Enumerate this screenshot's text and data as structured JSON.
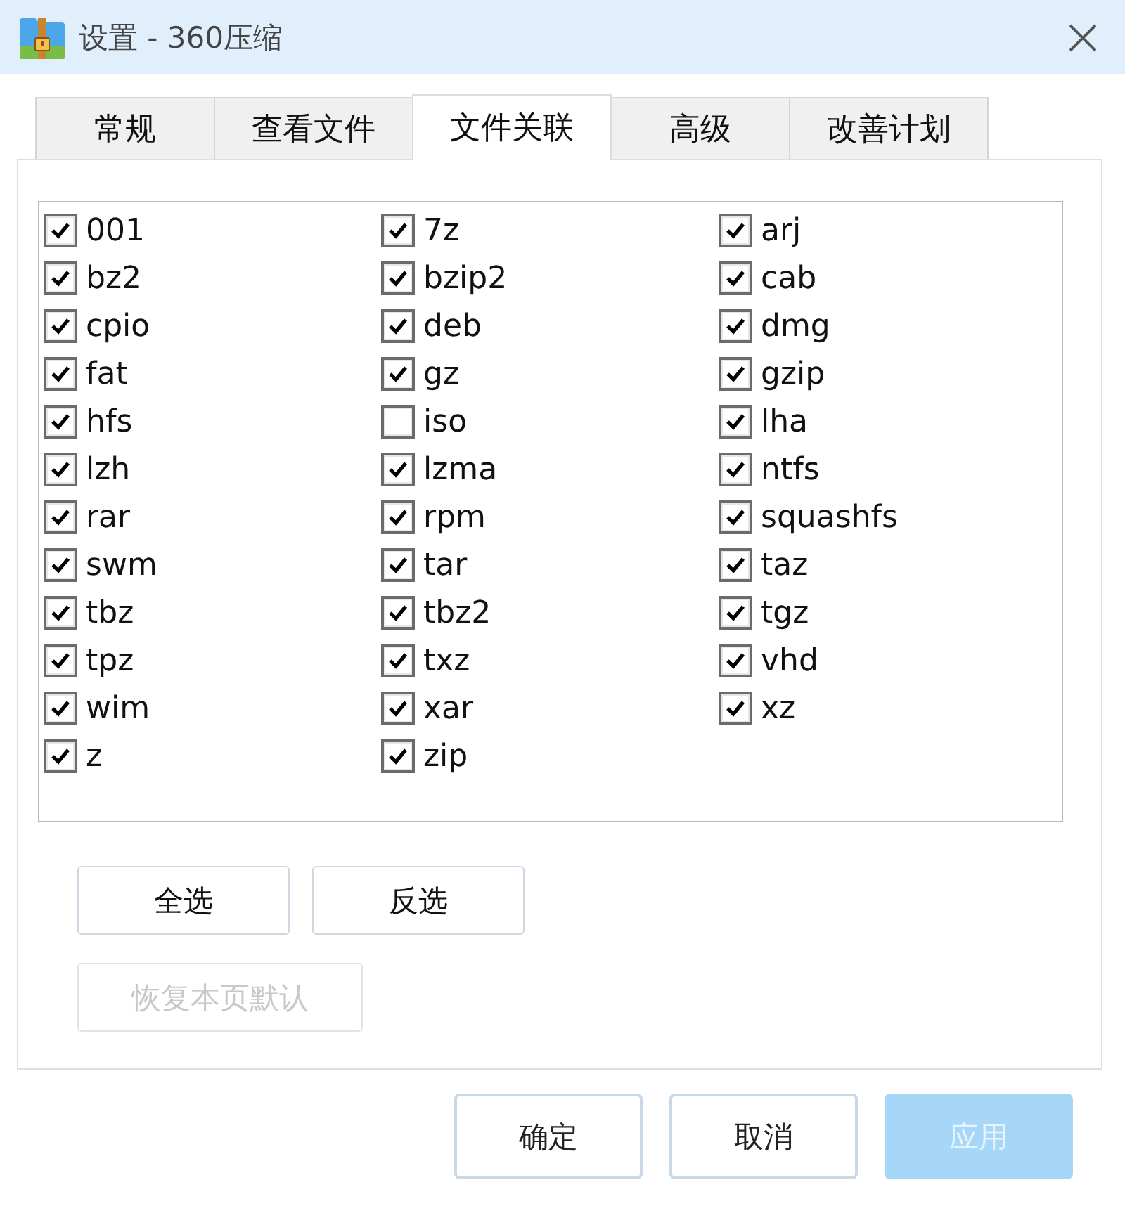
{
  "window": {
    "title": "设置 - 360压缩"
  },
  "tabs": [
    {
      "label": "常规",
      "selected": false
    },
    {
      "label": "查看文件",
      "selected": false
    },
    {
      "label": "文件关联",
      "selected": true
    },
    {
      "label": "高级",
      "selected": false
    },
    {
      "label": "改善计划",
      "selected": false
    }
  ],
  "file_types": [
    {
      "label": "001",
      "checked": true
    },
    {
      "label": "7z",
      "checked": true
    },
    {
      "label": "arj",
      "checked": true
    },
    {
      "label": "bz2",
      "checked": true
    },
    {
      "label": "bzip2",
      "checked": true
    },
    {
      "label": "cab",
      "checked": true
    },
    {
      "label": "cpio",
      "checked": true
    },
    {
      "label": "deb",
      "checked": true
    },
    {
      "label": "dmg",
      "checked": true
    },
    {
      "label": "fat",
      "checked": true
    },
    {
      "label": "gz",
      "checked": true
    },
    {
      "label": "gzip",
      "checked": true
    },
    {
      "label": "hfs",
      "checked": true
    },
    {
      "label": "iso",
      "checked": false
    },
    {
      "label": "lha",
      "checked": true
    },
    {
      "label": "lzh",
      "checked": true
    },
    {
      "label": "lzma",
      "checked": true
    },
    {
      "label": "ntfs",
      "checked": true
    },
    {
      "label": "rar",
      "checked": true
    },
    {
      "label": "rpm",
      "checked": true
    },
    {
      "label": "squashfs",
      "checked": true
    },
    {
      "label": "swm",
      "checked": true
    },
    {
      "label": "tar",
      "checked": true
    },
    {
      "label": "taz",
      "checked": true
    },
    {
      "label": "tbz",
      "checked": true
    },
    {
      "label": "tbz2",
      "checked": true
    },
    {
      "label": "tgz",
      "checked": true
    },
    {
      "label": "tpz",
      "checked": true
    },
    {
      "label": "txz",
      "checked": true
    },
    {
      "label": "vhd",
      "checked": true
    },
    {
      "label": "wim",
      "checked": true
    },
    {
      "label": "xar",
      "checked": true
    },
    {
      "label": "xz",
      "checked": true
    },
    {
      "label": "z",
      "checked": true
    },
    {
      "label": "zip",
      "checked": true
    }
  ],
  "list_actions": [
    {
      "label": "全选",
      "disabled": false
    },
    {
      "label": "反选",
      "disabled": false
    },
    {
      "label": "恢复本页默认",
      "disabled": true
    }
  ],
  "dialog_buttons": [
    {
      "label": "确定",
      "kind": "default",
      "disabled": false
    },
    {
      "label": "取消",
      "kind": "default",
      "disabled": false
    },
    {
      "label": "应用",
      "kind": "primary",
      "disabled": true
    }
  ]
}
